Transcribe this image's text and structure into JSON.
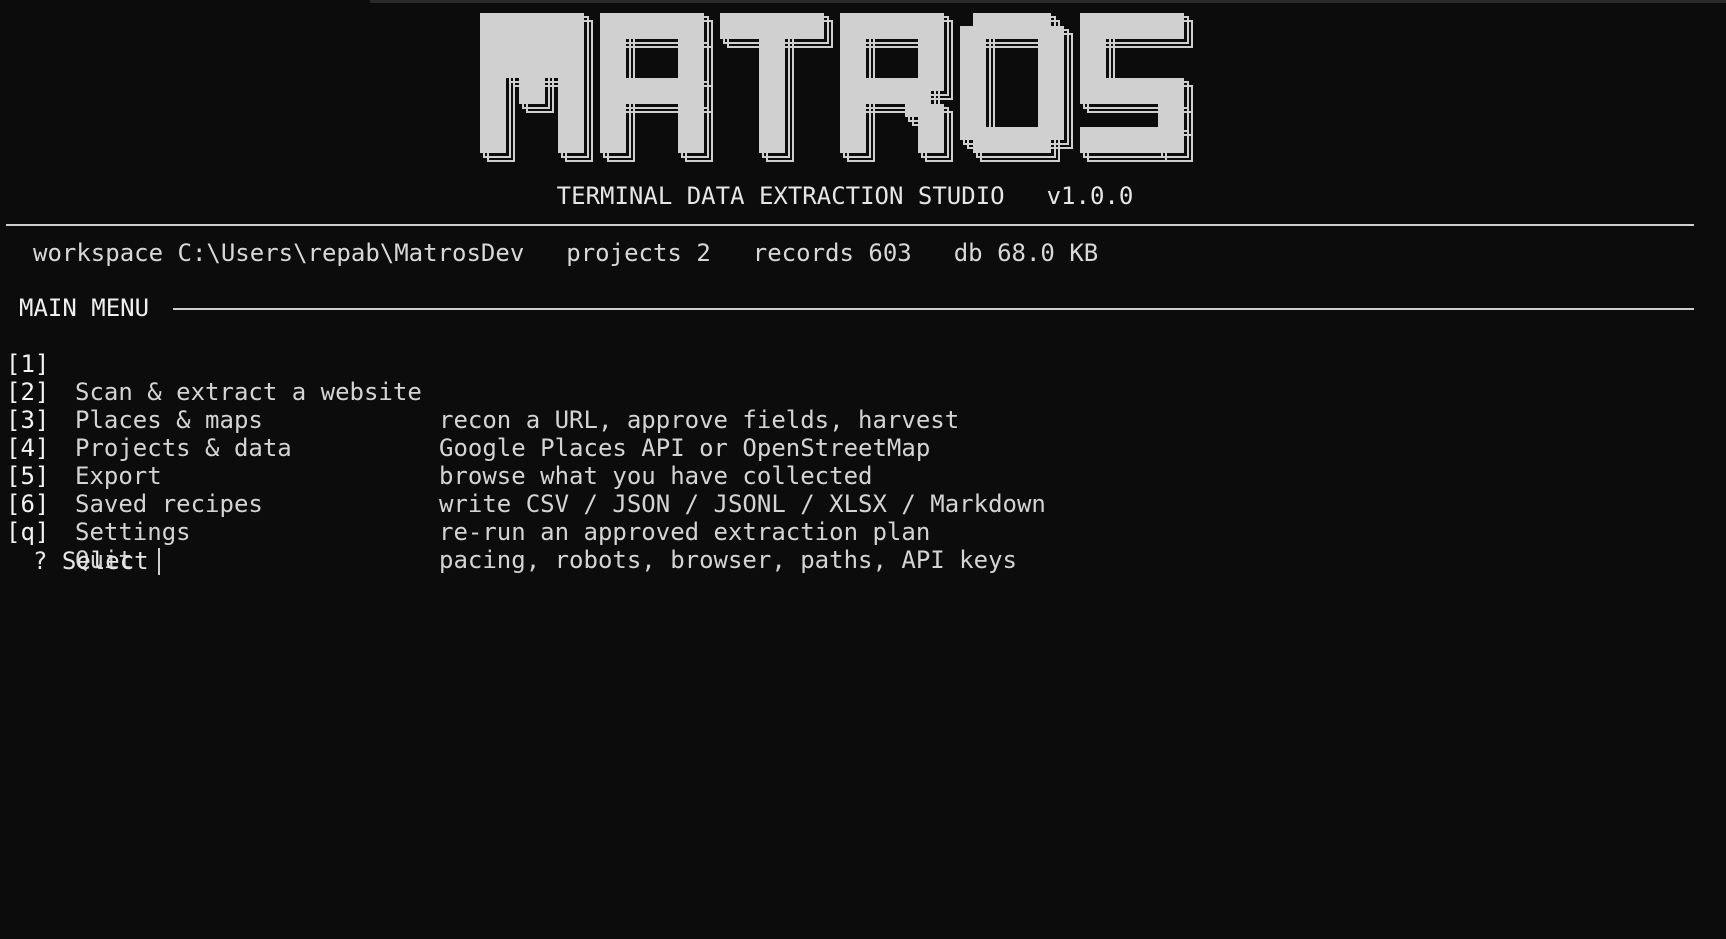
{
  "logo": {
    "text": "MATROS"
  },
  "header": {
    "subtitle": "TERMINAL DATA EXTRACTION STUDIO",
    "version": "v1.0.0"
  },
  "stats": {
    "workspace": "workspace C:\\Users\\repab\\MatrosDev",
    "projects": "projects 2",
    "records": "records 603",
    "db": "db 68.0 KB"
  },
  "menu": {
    "title": "MAIN MENU",
    "items": [
      {
        "key": "[1]",
        "label": "Scan & extract a website",
        "desc": "recon a URL, approve fields, harvest"
      },
      {
        "key": "[2]",
        "label": "Places & maps",
        "desc": "Google Places API or OpenStreetMap"
      },
      {
        "key": "[3]",
        "label": "Projects & data",
        "desc": "browse what you have collected"
      },
      {
        "key": "[4]",
        "label": "Export",
        "desc": "write CSV / JSON / JSONL / XLSX / Markdown"
      },
      {
        "key": "[5]",
        "label": "Saved recipes",
        "desc": "re-run an approved extraction plan"
      },
      {
        "key": "[6]",
        "label": "Settings",
        "desc": "pacing, robots, browser, paths, API keys"
      },
      {
        "key": "[q]",
        "label": "Quit",
        "desc": ""
      }
    ]
  },
  "prompt": {
    "text": "? Select"
  },
  "colors": {
    "background": "#0c0c0c",
    "text": "#cccccc",
    "logo_fill": "#d0d0d0"
  }
}
